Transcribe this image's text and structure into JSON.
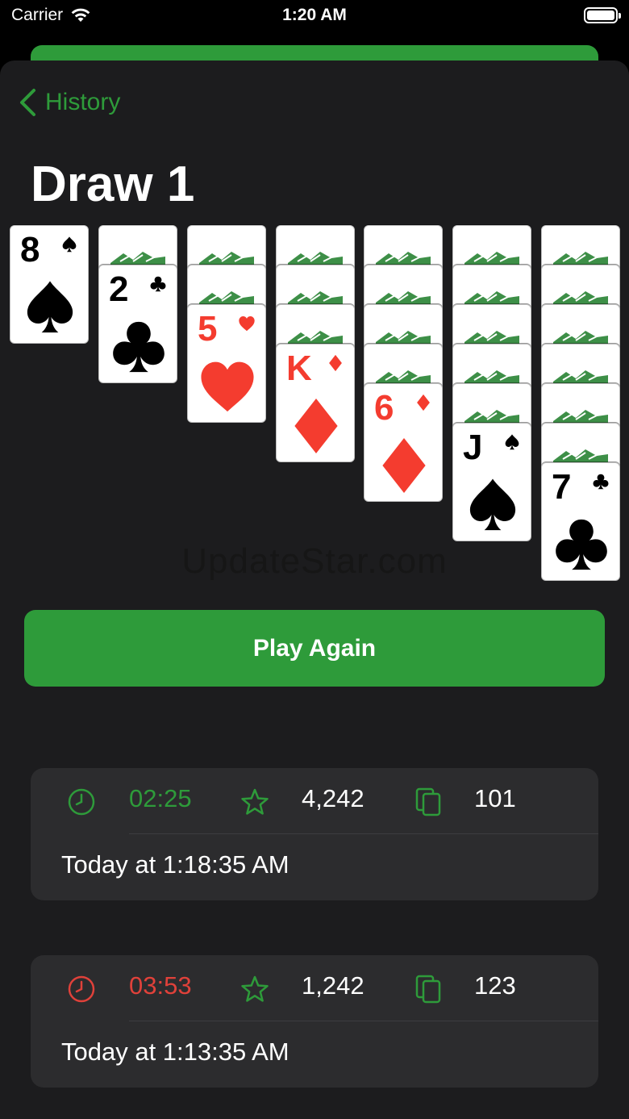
{
  "status_bar": {
    "carrier": "Carrier",
    "time": "1:20 AM"
  },
  "nav": {
    "back_label": "History"
  },
  "title": "Draw 1",
  "tableau": [
    {
      "face_down": 0,
      "rank": "8",
      "suit": "spade",
      "color": "black"
    },
    {
      "face_down": 1,
      "rank": "2",
      "suit": "club",
      "color": "black"
    },
    {
      "face_down": 2,
      "rank": "5",
      "suit": "heart",
      "color": "red"
    },
    {
      "face_down": 3,
      "rank": "K",
      "suit": "diamond",
      "color": "red"
    },
    {
      "face_down": 4,
      "rank": "6",
      "suit": "diamond",
      "color": "red"
    },
    {
      "face_down": 5,
      "rank": "J",
      "suit": "spade",
      "color": "black"
    },
    {
      "face_down": 6,
      "rank": "7",
      "suit": "club",
      "color": "black"
    }
  ],
  "watermark": "UpdateStar.com",
  "play_again_label": "Play Again",
  "games": [
    {
      "time": "02:25",
      "time_status": "won",
      "time_color": "#2e9b3a",
      "score": "4,242",
      "moves": "101",
      "date": "Today at 1:18:35 AM"
    },
    {
      "time": "03:53",
      "time_status": "lost",
      "time_color": "#e0413a",
      "score": "1,242",
      "moves": "123",
      "date": "Today at 1:13:35 AM"
    }
  ],
  "colors": {
    "accent": "#2e9b3a",
    "red_suit": "#f43c2f",
    "background": "#1c1c1e",
    "row_background": "#2c2c2e"
  }
}
